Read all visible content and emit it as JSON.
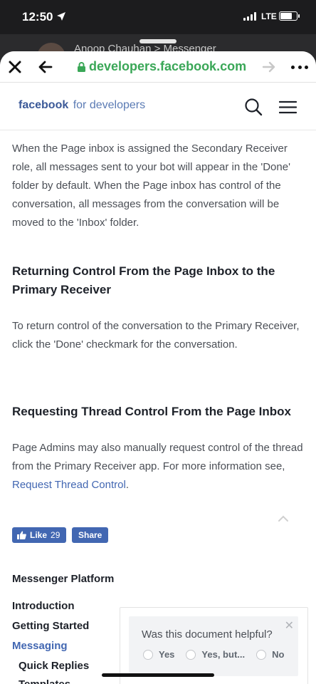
{
  "status_bar": {
    "time": "12:50",
    "network": "LTE",
    "battery_level": 0.75
  },
  "background_app": {
    "title": "Anoop Chauhan > Messenger"
  },
  "browser": {
    "url": "developers.facebook.com"
  },
  "site": {
    "logo_brand": "facebook",
    "logo_suffix": "for developers"
  },
  "article": {
    "para1": "When the Page inbox is assigned the Secondary Receiver role, all messages sent to your bot will appear in the 'Done' folder by default. When the Page inbox has control of the conversation, all messages from the conversation will be moved to the 'Inbox' folder.",
    "heading1": "Returning Control From the Page Inbox to the Primary Receiver",
    "para2": "To return control of the conversation to the Primary Receiver, click the 'Done' checkmark for the conversation.",
    "heading2": "Requesting Thread Control From the Page Inbox",
    "para3_text": "Page Admins may also manually request control of the thread from the Primary Receiver app. For more information see, ",
    "para3_link": "Request Thread Control",
    "para3_end": "."
  },
  "social": {
    "like_label": "Like",
    "like_count": "29",
    "share_label": "Share"
  },
  "nav": {
    "title": "Messenger Platform",
    "items": [
      "Introduction",
      "Getting Started",
      "Messaging"
    ],
    "sub_items": [
      "Quick Replies",
      "Templates"
    ]
  },
  "feedback": {
    "question": "Was this document helpful?",
    "options": [
      "Yes",
      "Yes, but...",
      "No"
    ]
  },
  "colors": {
    "accent": "#4267b2",
    "url_green": "#3aa757",
    "brand": "#3b5998"
  }
}
